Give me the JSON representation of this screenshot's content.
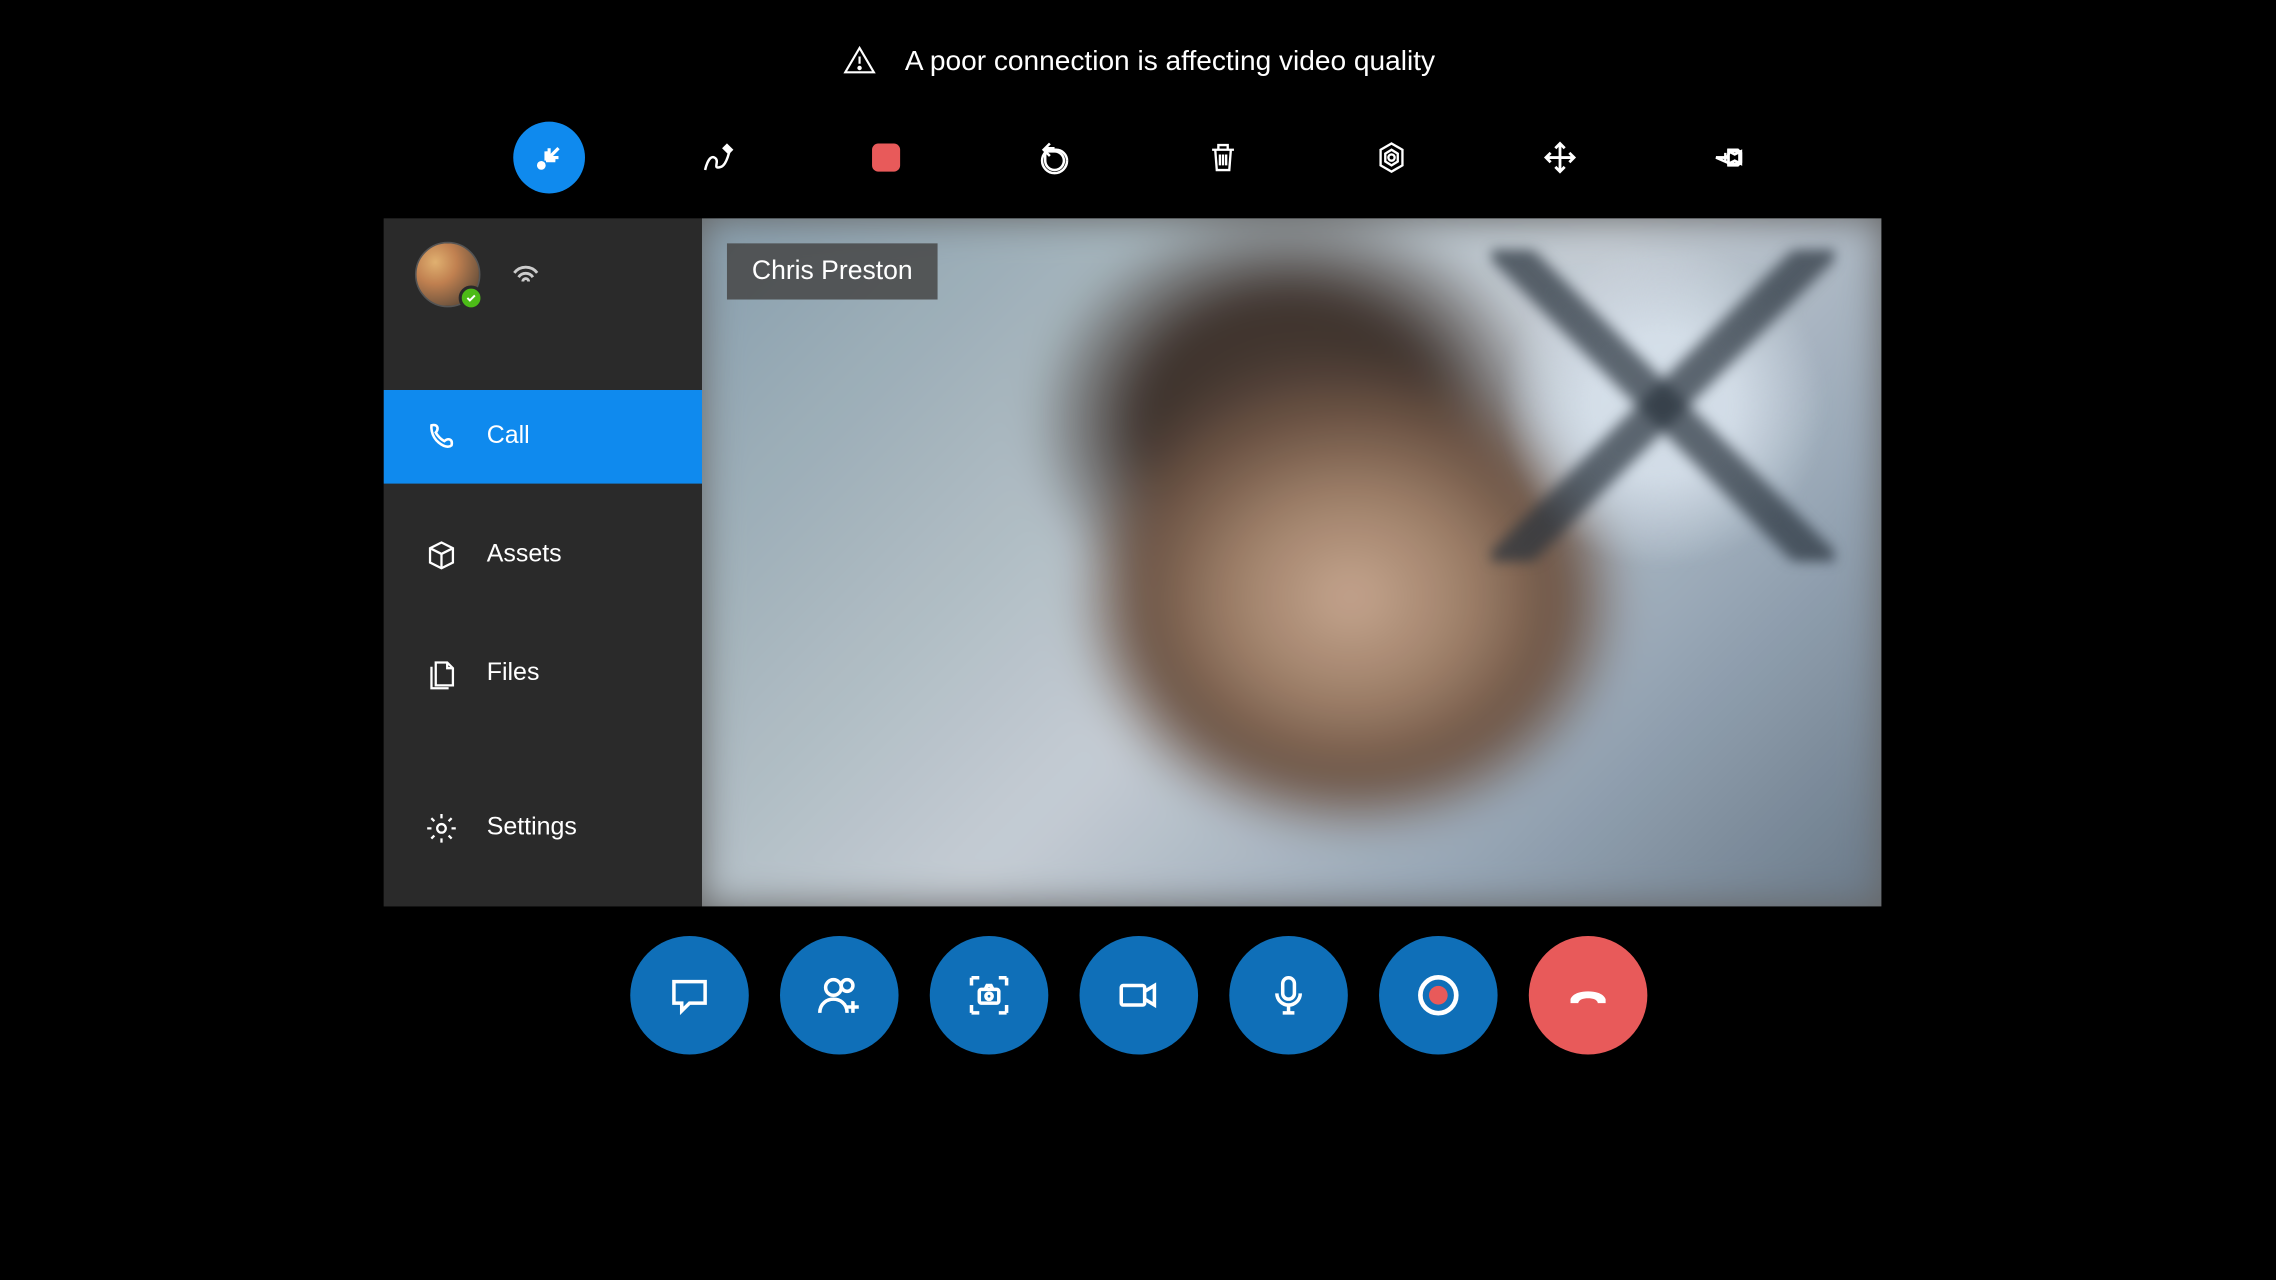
{
  "warning": {
    "text": "A poor connection is affecting video quality"
  },
  "toolbar": {
    "items": [
      {
        "name": "collapse",
        "active": true
      },
      {
        "name": "draw"
      },
      {
        "name": "stop-record"
      },
      {
        "name": "undo"
      },
      {
        "name": "delete"
      },
      {
        "name": "hexagon-settings"
      },
      {
        "name": "expand-arrows"
      },
      {
        "name": "pin"
      }
    ]
  },
  "sidebar": {
    "nav": {
      "call": {
        "label": "Call"
      },
      "assets": {
        "label": "Assets"
      },
      "files": {
        "label": "Files"
      },
      "settings": {
        "label": "Settings"
      }
    }
  },
  "video": {
    "participant_name": "Chris Preston"
  },
  "call_controls": {
    "items": [
      "chat",
      "add-participant",
      "screenshot",
      "video",
      "microphone",
      "record",
      "hangup"
    ]
  },
  "colors": {
    "accent": "#0f8aee",
    "button": "#0f6fb8",
    "danger": "#e85a5a"
  }
}
